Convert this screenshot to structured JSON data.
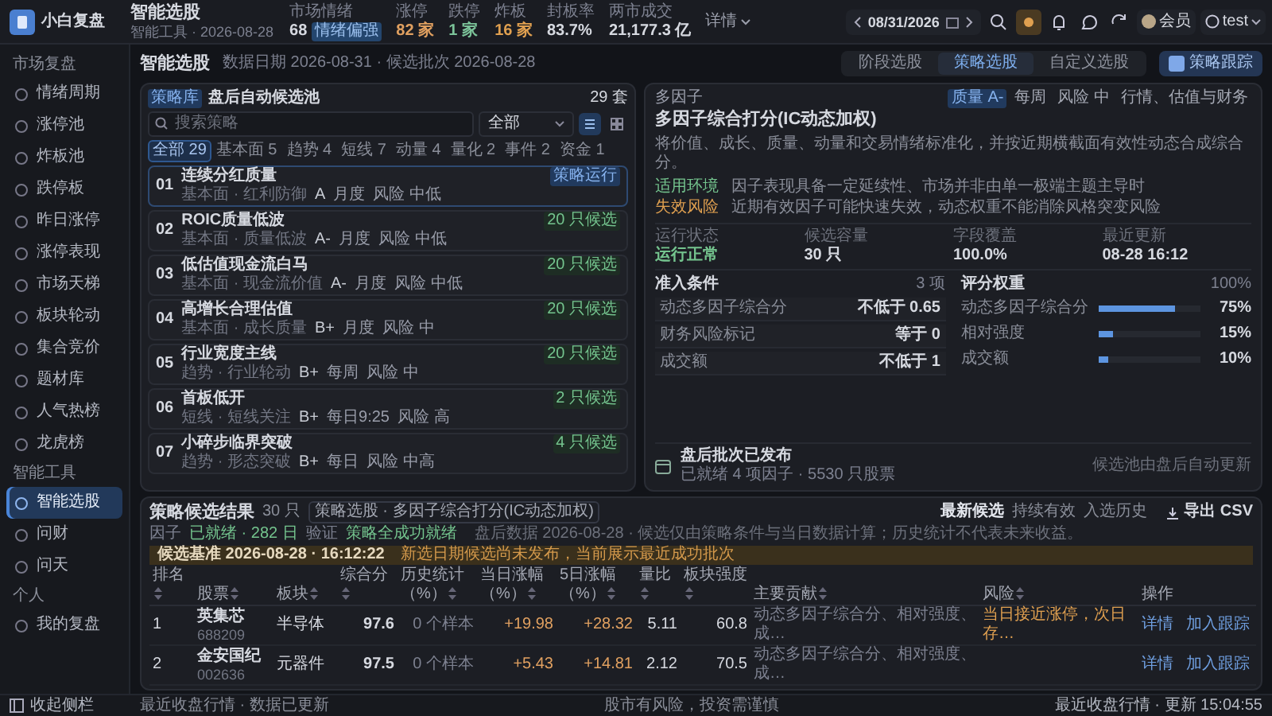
{
  "app": {
    "name": "小白复盘"
  },
  "topbar": {
    "title": "智能选股",
    "subtitle": "智能工具 · 2026-08-28",
    "stats": [
      {
        "label": "市场情绪",
        "value": "68",
        "badge": "情绪偏强",
        "kind": "plain"
      },
      {
        "label": "涨停",
        "value": "82 家",
        "kind": "up"
      },
      {
        "label": "跌停",
        "value": "1 家",
        "kind": "down"
      },
      {
        "label": "炸板",
        "value": "16 家",
        "kind": "warn"
      },
      {
        "label": "封板率",
        "value": "83.7%",
        "kind": "plain"
      },
      {
        "label": "两市成交",
        "value": "21,177.3 亿",
        "kind": "plain"
      }
    ],
    "details": "详情",
    "date": "08/31/2026",
    "member": "会员",
    "user": "test"
  },
  "sidebar": {
    "sections": [
      {
        "label": "市场复盘",
        "items": [
          {
            "label": "情绪周期",
            "selected": false
          },
          {
            "label": "涨停池",
            "selected": false
          },
          {
            "label": "炸板池",
            "selected": false
          },
          {
            "label": "跌停板",
            "selected": false
          },
          {
            "label": "昨日涨停",
            "selected": false
          },
          {
            "label": "涨停表现",
            "selected": false
          },
          {
            "label": "市场天梯",
            "selected": false
          },
          {
            "label": "板块轮动",
            "selected": false
          },
          {
            "label": "集合竞价",
            "selected": false
          },
          {
            "label": "题材库",
            "selected": false
          },
          {
            "label": "人气热榜",
            "selected": false
          },
          {
            "label": "龙虎榜",
            "selected": false
          }
        ]
      },
      {
        "label": "智能工具",
        "items": [
          {
            "label": "智能选股",
            "selected": true
          },
          {
            "label": "问财",
            "selected": false
          },
          {
            "label": "问天",
            "selected": false
          }
        ]
      },
      {
        "label": "个人",
        "items": [
          {
            "label": "我的复盘",
            "selected": false
          }
        ]
      }
    ],
    "collapse": "收起侧栏"
  },
  "page": {
    "title": "智能选股",
    "meta": "数据日期 2026-08-31 · 候选批次 2026-08-28",
    "tabs": [
      {
        "label": "阶段选股",
        "selected": false
      },
      {
        "label": "策略选股",
        "selected": true
      },
      {
        "label": "自定义选股",
        "selected": false
      }
    ],
    "track_button": "策略跟踪"
  },
  "library": {
    "badge": "策略库",
    "title": "盘后自动候选池",
    "count": "29 套",
    "search": {
      "placeholder": "搜索策略"
    },
    "select": "全部",
    "views": [
      {
        "selected": true
      },
      {
        "selected": false
      }
    ],
    "chips": [
      {
        "label": "全部 29",
        "selected": true
      },
      {
        "label": "基本面 5",
        "selected": false
      },
      {
        "label": "趋势 4",
        "selected": false
      },
      {
        "label": "短线 7",
        "selected": false
      },
      {
        "label": "动量 4",
        "selected": false
      },
      {
        "label": "量化 2",
        "selected": false
      },
      {
        "label": "事件 2",
        "selected": false
      },
      {
        "label": "资金 1",
        "selected": false
      }
    ],
    "items": [
      {
        "no": "01",
        "name": "连续分红质量",
        "sub": "基本面 · 红利防御",
        "grade": "A",
        "freq": "月度",
        "risk": "风险 中低",
        "tag": "策略运行",
        "kind": "running",
        "selected": true
      },
      {
        "no": "02",
        "name": "ROIC质量低波",
        "sub": "基本面 · 质量低波",
        "grade": "A-",
        "freq": "月度",
        "risk": "风险 中低",
        "tag": "20 只候选",
        "kind": "count",
        "selected": false
      },
      {
        "no": "03",
        "name": "低估值现金流白马",
        "sub": "基本面 · 现金流价值",
        "grade": "A-",
        "freq": "月度",
        "risk": "风险 中低",
        "tag": "20 只候选",
        "kind": "count",
        "selected": false
      },
      {
        "no": "04",
        "name": "高增长合理估值",
        "sub": "基本面 · 成长质量",
        "grade": "B+",
        "freq": "月度",
        "risk": "风险 中",
        "tag": "20 只候选",
        "kind": "count",
        "selected": false
      },
      {
        "no": "05",
        "name": "行业宽度主线",
        "sub": "趋势 · 行业轮动",
        "grade": "B+",
        "freq": "每周",
        "risk": "风险 中",
        "tag": "20 只候选",
        "kind": "count",
        "selected": false
      },
      {
        "no": "06",
        "name": "首板低开",
        "sub": "短线 · 短线关注",
        "grade": "B+",
        "freq": "每日9:25",
        "risk": "风险 高",
        "tag": "2 只候选",
        "kind": "count",
        "selected": false
      },
      {
        "no": "07",
        "name": "小碎步临界突破",
        "sub": "趋势 · 形态突破",
        "grade": "B+",
        "freq": "每日",
        "risk": "风险 中高",
        "tag": "4 只候选",
        "kind": "count",
        "selected": false
      }
    ]
  },
  "strategy": {
    "category": "多因子",
    "title": "多因子综合打分(IC动态加权)",
    "tags": [
      {
        "label": "质量 A-",
        "kind": "grade"
      },
      {
        "label": "每周",
        "kind": "plain"
      },
      {
        "label": "风险 中",
        "kind": "plain"
      },
      {
        "label": "行情、估值与财务",
        "kind": "plain"
      }
    ],
    "description": "将价值、成长、质量、动量和交易情绪标准化，并按近期横截面有效性动态合成综合分。",
    "notes": [
      {
        "label": "适用环境",
        "text": "因子表现具备一定延续性、市场并非由单一极端主题主导时",
        "kind": "good"
      },
      {
        "label": "失效风险",
        "text": "近期有效因子可能快速失效，动态权重不能消除风格突变风险",
        "kind": "risk"
      }
    ],
    "facts": [
      {
        "label": "运行状态",
        "value": "运行正常",
        "kind": "good"
      },
      {
        "label": "候选容量",
        "value": "30 只",
        "kind": "plain"
      },
      {
        "label": "字段覆盖",
        "value": "100.0%",
        "kind": "plain"
      },
      {
        "label": "最近更新",
        "value": "08-28 16:12",
        "kind": "plain"
      }
    ],
    "conditions": {
      "title": "准入条件",
      "count": "3 项",
      "rows": [
        {
          "name": "动态多因子综合分",
          "rule": "不低于 0.65"
        },
        {
          "name": "财务风险标记",
          "rule": "等于 0"
        },
        {
          "name": "成交额",
          "rule": "不低于 1"
        }
      ]
    },
    "weights": {
      "title": "评分权重",
      "total": "100%",
      "rows": [
        {
          "name": "动态多因子综合分",
          "level": 0.75,
          "reading": "75%"
        },
        {
          "name": "相对强度",
          "level": 0.15,
          "reading": "15%"
        },
        {
          "name": "成交额",
          "level": 0.1,
          "reading": "10%"
        }
      ]
    },
    "footer": {
      "title": "盘后批次已发布",
      "detail": "已就绪 4 项因子 · 5530 只股票",
      "note": "候选池由盘后自动更新"
    }
  },
  "results": {
    "title": "策略候选结果",
    "count": "30 只",
    "source": "策略选股 · 多因子综合打分(IC动态加权)",
    "factor_label": "因子",
    "factor_value": "已就绪 · 282 日",
    "check_label": "验证",
    "check_value": "策略全成功就绪",
    "tabs": [
      {
        "label": "最新候选",
        "selected": true
      },
      {
        "label": "持续有效",
        "selected": false
      },
      {
        "label": "入选历史",
        "selected": false
      }
    ],
    "note": "盘后数据 2026-08-28 · 候选仅由策略条件与当日数据计算；历史统计不代表未来收益。",
    "export": "导出 CSV",
    "banner": {
      "label": "候选基准 2026-08-28 · 16:12:22",
      "text": "新选日期候选尚未发布，当前展示最近成功批次"
    },
    "columns": [
      {
        "label": "排名",
        "sortable": true
      },
      {
        "label": "股票",
        "sortable": true
      },
      {
        "label": "板块",
        "sortable": true
      },
      {
        "label": "综合分",
        "sortable": true
      },
      {
        "label": "历史统计（%）",
        "sortable": true
      },
      {
        "label": "当日涨幅（%）",
        "sortable": true
      },
      {
        "label": "5日涨幅（%）",
        "sortable": true
      },
      {
        "label": "量比",
        "sortable": true
      },
      {
        "label": "板块强度",
        "sortable": true
      },
      {
        "label": "主要贡献",
        "sortable": true
      },
      {
        "label": "风险",
        "sortable": true
      },
      {
        "label": "操作",
        "sortable": false
      }
    ],
    "rows": [
      {
        "rank": "1",
        "name": "英集芯",
        "code": "688209",
        "sector": "半导体",
        "score": "97.6",
        "history": "0 个样本",
        "change_1d": "+19.98",
        "change_5d": "+28.32",
        "volume_ratio": "5.11",
        "strength": "60.8",
        "contribution": "动态多因子综合分、相对强度、成…",
        "risk": "当日接近涨停，次日存…",
        "actions": [
          "详情",
          "加入跟踪"
        ]
      },
      {
        "rank": "2",
        "name": "金安国纪",
        "code": "002636",
        "sector": "元器件",
        "score": "97.5",
        "history": "0 个样本",
        "change_1d": "+5.43",
        "change_5d": "+14.81",
        "volume_ratio": "2.12",
        "strength": "70.5",
        "contribution": "动态多因子综合分、相对强度、成…",
        "actions": [
          "详情",
          "加入跟踪"
        ]
      }
    ]
  },
  "status_bar": {
    "left": "最近收盘行情 · 数据已更新",
    "center": "股市有风险，投资需谨慎",
    "right": "最近收盘行情 · 更新 15:04:55"
  }
}
